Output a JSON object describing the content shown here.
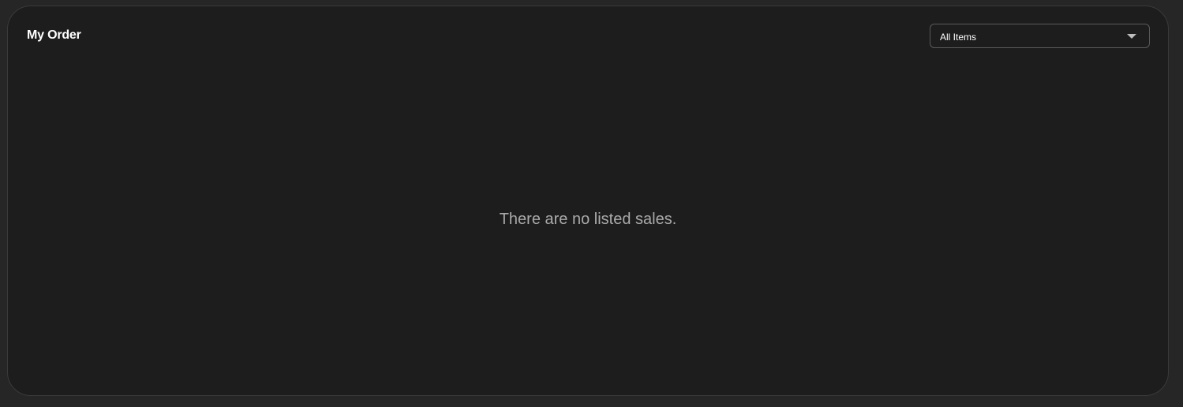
{
  "panel": {
    "title": "My Order"
  },
  "filter": {
    "selected": "All Items",
    "icon": "chevron-down-icon"
  },
  "empty_state": {
    "message": "There are no listed sales."
  },
  "colors": {
    "page_background": "#262626",
    "panel_background": "#1d1d1d",
    "title_text": "#ffffff",
    "muted_text": "#a9a9a9"
  }
}
